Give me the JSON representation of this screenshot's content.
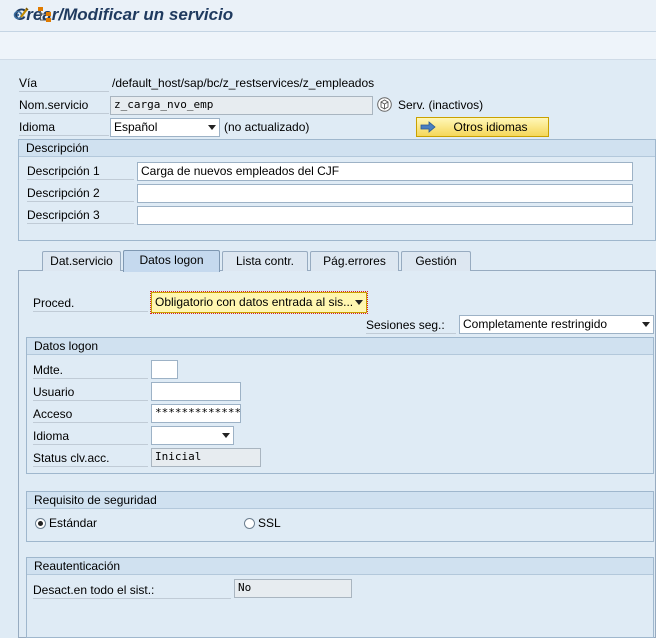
{
  "window": {
    "title": "Crear/Modificar un servicio"
  },
  "toolbar": {
    "icons": [
      "change-display-icon",
      "hierarchy-icon"
    ]
  },
  "header": {
    "via_label": "Vía",
    "via_value": "/default_host/sap/bc/z_restservices/z_empleados",
    "nom_label": "Nom.servicio",
    "nom_value": "z_carga_nvo_emp",
    "serv_status": "Serv. (inactivos)",
    "idioma_label": "Idioma",
    "idioma_value": "Español",
    "idioma_note": "(no actualizado)",
    "otros_idiomas_label": "Otros idiomas"
  },
  "descripcion": {
    "title": "Descripción",
    "desc1_label": "Descripción 1",
    "desc1_value": "Carga de nuevos empleados del CJF",
    "desc2_label": "Descripción 2",
    "desc2_value": "",
    "desc3_label": "Descripción 3",
    "desc3_value": ""
  },
  "tabs": [
    {
      "label": "Dat.servicio"
    },
    {
      "label": "Datos logon"
    },
    {
      "label": "Lista contr."
    },
    {
      "label": "Pág.errores"
    },
    {
      "label": "Gestión"
    }
  ],
  "active_tab": "Datos logon",
  "logon": {
    "proced_label": "Proced.",
    "proced_value": "Obligatorio con datos entrada al sis...",
    "sesiones_label": "Sesiones seg.:",
    "sesiones_value": "Completamente restringido",
    "datos_title": "Datos logon",
    "mdte_label": "Mdte.",
    "mdte_value": "",
    "usuario_label": "Usuario",
    "usuario_value": "",
    "acceso_label": "Acceso",
    "acceso_value": "*************",
    "idioma_label": "Idioma",
    "idioma_value": "",
    "status_label": "Status clv.acc.",
    "status_value": "Inicial"
  },
  "seguridad": {
    "title": "Requisito de seguridad",
    "opt1": "Estándar",
    "opt2": "SSL",
    "selected": "Estándar"
  },
  "reauth": {
    "title": "Reautenticación",
    "desact_label": "Desact.en todo el sist.:",
    "desact_value": "No"
  }
}
